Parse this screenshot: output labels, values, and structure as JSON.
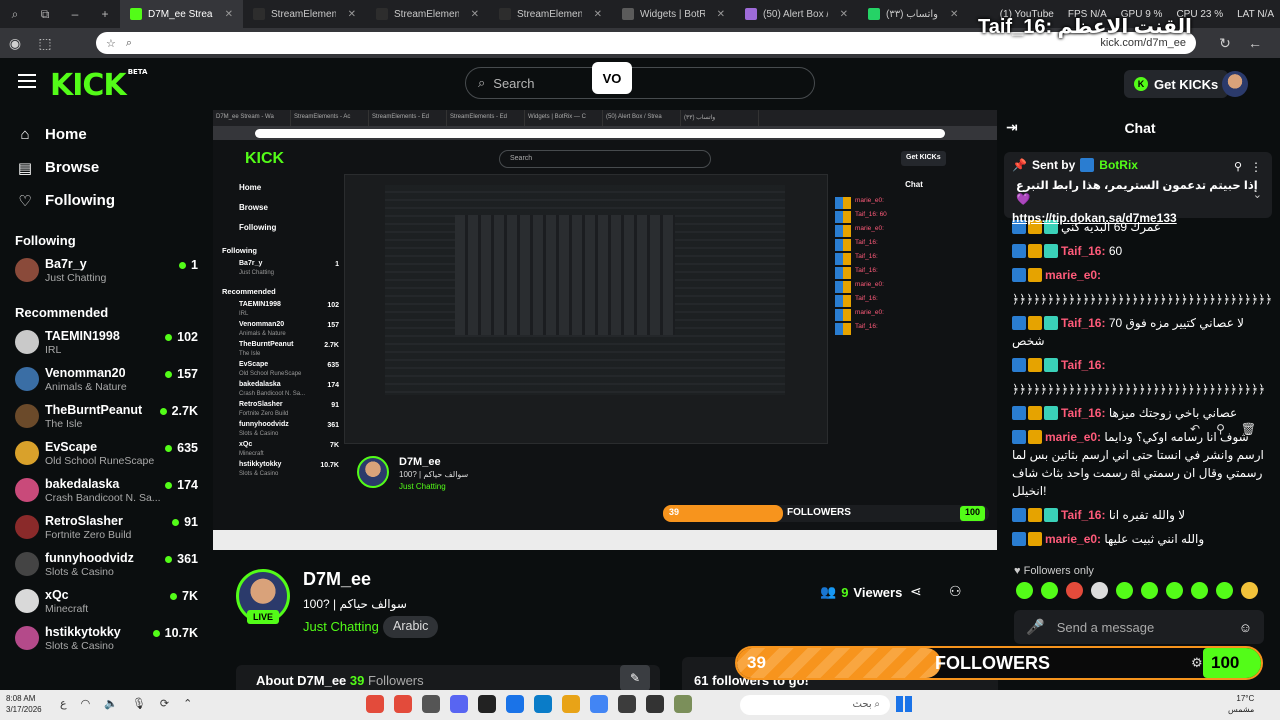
{
  "browser": {
    "tabs": [
      {
        "label": "D7M_ee Stream - Wa",
        "color": "#53fc18",
        "active": true
      },
      {
        "label": "StreamElements - Ac",
        "color": "#2d2d2d",
        "active": false
      },
      {
        "label": "StreamElements - Ed",
        "color": "#2d2d2d",
        "active": false
      },
      {
        "label": "StreamElements - Ed",
        "color": "#2d2d2d",
        "active": false
      },
      {
        "label": "Widgets | BotRix — C",
        "color": "#5b5b5b",
        "active": false
      },
      {
        "label": "(50) Alert Box / Strea",
        "color": "#9e6bd8",
        "active": false
      },
      {
        "label": "واتساب (٣٣)",
        "color": "#25d366",
        "active": false
      }
    ],
    "right_items": [
      "(1) YouTube",
      "FPS N/A",
      "GPU 9 %",
      "CPU 23 %",
      "LAT N/A"
    ],
    "url": "kick.com/d7m_ee",
    "overlay_title": "Taif_16: القنت الاعظم"
  },
  "header": {
    "logo": "KICK",
    "logo_sup": "BETA",
    "search_placeholder": "Search",
    "get_kicks": "Get KICKs",
    "vo_badge": "VO"
  },
  "sidebar": {
    "nav": [
      {
        "label": "Home",
        "icon": "home-icon"
      },
      {
        "label": "Browse",
        "icon": "browse-icon"
      },
      {
        "label": "Following",
        "icon": "heart-icon"
      }
    ],
    "following_title": "Following",
    "following": [
      {
        "name": "Ba7r_y",
        "category": "Just Chatting",
        "viewers": "1",
        "color": "#8a4a3a"
      }
    ],
    "recommended_title": "Recommended",
    "recommended": [
      {
        "name": "TAEMIN1998",
        "category": "IRL",
        "viewers": "102",
        "color": "#c9c9c9"
      },
      {
        "name": "Venomman20",
        "category": "Animals & Nature",
        "viewers": "157",
        "color": "#3a6ea5"
      },
      {
        "name": "TheBurntPeanut",
        "category": "The Isle",
        "viewers": "2.7K",
        "color": "#6b4a2a"
      },
      {
        "name": "EvScape",
        "category": "Old School RuneScape",
        "viewers": "635",
        "color": "#d9a12b"
      },
      {
        "name": "bakedalaska",
        "category": "Crash Bandicoot N. Sa...",
        "viewers": "174",
        "color": "#c94a7a"
      },
      {
        "name": "RetroSlasher",
        "category": "Fortnite Zero Build",
        "viewers": "91",
        "color": "#8a2a2a"
      },
      {
        "name": "funnyhoodvidz",
        "category": "Slots & Casino",
        "viewers": "361",
        "color": "#444"
      },
      {
        "name": "xQc",
        "category": "Minecraft",
        "viewers": "7K",
        "color": "#d9d9d9"
      },
      {
        "name": "hstikkytokky",
        "category": "Slots & Casino",
        "viewers": "10.7K",
        "color": "#b44a8a"
      }
    ]
  },
  "video": {
    "inner": {
      "search": "Search",
      "get_kicks": "Get KICKs",
      "chat_title": "Chat",
      "nav": [
        "Home",
        "Browse",
        "Following"
      ],
      "following_title": "Following",
      "recommended_title": "Recommended",
      "channels": [
        {
          "name": "Ba7r_y",
          "cat": "Just Chatting",
          "v": "1"
        },
        {
          "name": "TAEMIN1998",
          "cat": "IRL",
          "v": "102"
        },
        {
          "name": "Venomman20",
          "cat": "Animals & Nature",
          "v": "157"
        },
        {
          "name": "TheBurntPeanut",
          "cat": "The Isle",
          "v": "2.7K"
        },
        {
          "name": "EvScape",
          "cat": "Old School RuneScape",
          "v": "635"
        },
        {
          "name": "bakedalaska",
          "cat": "Crash Bandicoot N. Sa...",
          "v": "174"
        },
        {
          "name": "RetroSlasher",
          "cat": "Fortnite Zero Build",
          "v": "91"
        },
        {
          "name": "funnyhoodvidz",
          "cat": "Slots & Casino",
          "v": "361"
        },
        {
          "name": "xQc",
          "cat": "Minecraft",
          "v": "7K"
        },
        {
          "name": "hstikkytokky",
          "cat": "Slots & Casino",
          "v": "10.7K"
        }
      ],
      "chat_lines": [
        "marie_e0:",
        "Taif_16: 60",
        "marie_e0:",
        "Taif_16:",
        "Taif_16:",
        "Taif_16:",
        "marie_e0:",
        "Taif_16:",
        "marie_e0:",
        "Taif_16:"
      ],
      "streamer_name": "D7M_ee",
      "streamer_title": "100? | سوالف حياكم",
      "streamer_cat": "Just Chatting",
      "goal_current": "39",
      "goal_label": "FOLLOWERS",
      "goal_target": "100"
    }
  },
  "channel": {
    "name": "D7M_ee",
    "title": "100? | سوالف حياكم",
    "category": "Just Chatting",
    "tag": "Arabic",
    "live": "LIVE",
    "viewers_count": "9",
    "viewers_label": "Viewers",
    "about_prefix": "About D7M_ee",
    "about_count": "39",
    "about_suffix": "Followers",
    "followers_to_go": "61 followers to go!"
  },
  "chat": {
    "title": "Chat",
    "pinned": {
      "sent_by": "Sent by",
      "bot_name": "BotRix",
      "text": "إذا حبيتم تدعمون الستريمر، هذا رابط التبرع 💜",
      "link": "https://tip.dokan.sa/d7me133"
    },
    "messages": [
      {
        "user": "",
        "text": "عمرك 69 البديه كني",
        "color": "#ff5b7a",
        "badges": [
          "blue",
          "gold",
          "teal"
        ]
      },
      {
        "user": "Taif_16:",
        "text": "60",
        "color": "#ff5b7a",
        "badges": [
          "blue",
          "gold",
          "teal"
        ]
      },
      {
        "user": "marie_e0:",
        "text": "",
        "color": "#ff5b7a",
        "badges": [
          "blue",
          "gold"
        ]
      },
      {
        "user": "",
        "text": "﴿﴿﴿﴿﴿﴿﴿﴿﴿﴿﴿﴿﴿﴿﴿﴿﴿﴿﴿﴿﴿﴿﴿﴿﴿﴿﴿﴿﴿﴿﴿﴿﴿﴿﴿﴿﴿",
        "color": "#fff",
        "badges": []
      },
      {
        "user": "Taif_16:",
        "text": "لا عصاني كتيير مزه فوق 70 شخص",
        "color": "#ff5b7a",
        "badges": [
          "blue",
          "gold",
          "teal"
        ]
      },
      {
        "user": "Taif_16:",
        "text": "",
        "color": "#ff5b7a",
        "badges": [
          "blue",
          "gold",
          "teal"
        ]
      },
      {
        "user": "",
        "text": "﴿﴿﴿﴿﴿﴿﴿﴿﴿﴿﴿﴿﴿﴿﴿﴿﴿﴿﴿﴿﴿﴿﴿﴿﴿﴿﴿﴿﴿﴿﴿﴿﴿﴿﴿﴿",
        "color": "#fff",
        "badges": []
      },
      {
        "user": "Taif_16:",
        "text": "عصاني باخي زوجتك ميزها",
        "color": "#ff5b7a",
        "badges": [
          "blue",
          "gold",
          "teal"
        ]
      },
      {
        "user": "marie_e0:",
        "text": "شوف انا رسامه اوكي؟ ودايما ارسم وانشر في انستا حتى اني ارسم بثاتين بس لما رسمت واحد بثاث شاف ai رسمتي وقال ان رسمتي !انخيلل",
        "color": "#ff5b7a",
        "badges": [
          "blue",
          "gold"
        ]
      },
      {
        "user": "Taif_16:",
        "text": "لا والله تفيره انا",
        "color": "#ff5b7a",
        "badges": [
          "blue",
          "gold",
          "teal"
        ]
      },
      {
        "user": "marie_e0:",
        "text": "والله انني ثبيت عليها",
        "color": "#ff5b7a",
        "badges": [
          "blue",
          "gold"
        ]
      }
    ],
    "followers_only": "Followers only",
    "send_placeholder": "Send a message"
  },
  "goal_overlay": {
    "current": "39",
    "label": "FOLLOWERS",
    "target": "100",
    "progress_fraction": 0.39
  },
  "taskbar": {
    "time": "8:08 AM",
    "date": "3/17/2026",
    "search": "بحث",
    "weather_temp": "17°C",
    "weather_desc": "مشمس"
  }
}
